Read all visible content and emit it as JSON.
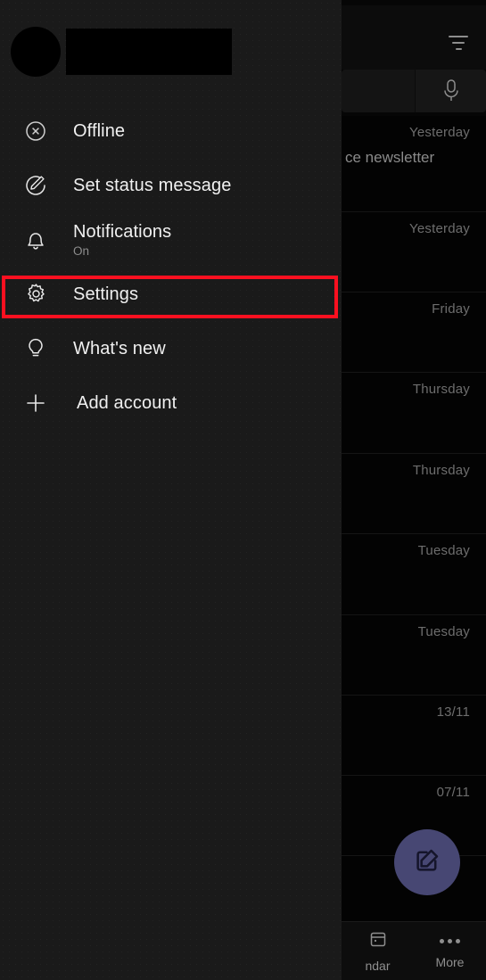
{
  "app": {
    "accent_purple": "#474773",
    "highlight_color": "#fb1020",
    "drawer_bg": "#1a1a1a",
    "page_bg": "#000000"
  },
  "drawer": {
    "account": {
      "avatar_label": "account-avatar",
      "name_redacted": true
    },
    "items": [
      {
        "id": "offline",
        "icon": "circle-x-icon",
        "label": "Offline",
        "sub": ""
      },
      {
        "id": "set-status-message",
        "icon": "circle-pencil-icon",
        "label": "Set status message",
        "sub": ""
      },
      {
        "id": "notifications",
        "icon": "bell-icon",
        "label": "Notifications",
        "sub": "On"
      },
      {
        "id": "settings",
        "icon": "gear-icon",
        "label": "Settings",
        "sub": ""
      },
      {
        "id": "whats-new",
        "icon": "lightbulb-icon",
        "label": "What's new",
        "sub": ""
      },
      {
        "id": "add-account",
        "icon": "plus-icon",
        "label": "Add account",
        "sub": ""
      }
    ],
    "highlighted_item": "settings"
  },
  "background": {
    "toolbar": {
      "filter_icon": "filter-icon"
    },
    "search": {
      "placeholder": "",
      "value": "",
      "mic_icon": "microphone-icon"
    },
    "mail_rows": [
      {
        "date": "Yesterday",
        "snippet": "ce newsletter"
      },
      {
        "date": "Yesterday",
        "snippet": ""
      },
      {
        "date": "Friday",
        "snippet": ""
      },
      {
        "date": "Thursday",
        "snippet": ""
      },
      {
        "date": "Thursday",
        "snippet": ""
      },
      {
        "date": "Tuesday",
        "snippet": ""
      },
      {
        "date": "Tuesday",
        "snippet": ""
      },
      {
        "date": "13/11",
        "snippet": ""
      },
      {
        "date": "07/11",
        "snippet": ""
      }
    ],
    "compose_fab": {
      "icon": "compose-icon",
      "label": ""
    },
    "bottom_nav": [
      {
        "id": "calendar",
        "icon": "calendar-icon",
        "label": "ndar"
      },
      {
        "id": "more",
        "icon": "more-dots-icon",
        "label": "More"
      }
    ]
  }
}
